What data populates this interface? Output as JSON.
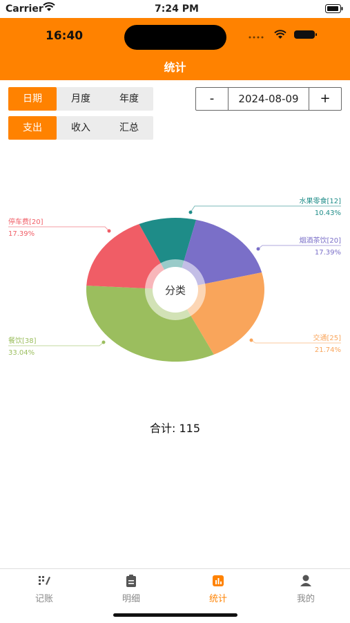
{
  "sim_status": {
    "carrier": "Carrier",
    "time": "7:24 PM"
  },
  "device_status": {
    "time": "16:40"
  },
  "header": {
    "title": "统计"
  },
  "period_tabs": [
    {
      "label": "日期",
      "active": true
    },
    {
      "label": "月度",
      "active": false
    },
    {
      "label": "年度",
      "active": false
    }
  ],
  "type_tabs": [
    {
      "label": "支出",
      "active": true
    },
    {
      "label": "收入",
      "active": false
    },
    {
      "label": "汇总",
      "active": false
    }
  ],
  "date_control": {
    "minus": "-",
    "value": "2024-08-09",
    "plus": "+"
  },
  "chart_data": {
    "type": "pie",
    "center_label": "分类",
    "slices": [
      {
        "label": "水果零食[12]",
        "percent": "10.43%",
        "value": 12,
        "color": "#1E8C88"
      },
      {
        "label": "烟酒茶饮[20]",
        "percent": "17.39%",
        "value": 20,
        "color": "#7A6FC8"
      },
      {
        "label": "交通[25]",
        "percent": "21.74%",
        "value": 25,
        "color": "#F9A55B"
      },
      {
        "label": "餐饮[38]",
        "percent": "33.04%",
        "value": 38,
        "color": "#9BBE5E"
      },
      {
        "label": "停车费[20]",
        "percent": "17.39%",
        "value": 20,
        "color": "#F05D66"
      }
    ]
  },
  "total": {
    "text": "合计: 115"
  },
  "tabbar": [
    {
      "label": "记账",
      "icon": "bookkeeping-icon",
      "active": false
    },
    {
      "label": "明细",
      "icon": "clipboard-icon",
      "active": false
    },
    {
      "label": "统计",
      "icon": "bar-chart-icon",
      "active": true
    },
    {
      "label": "我的",
      "icon": "person-icon",
      "active": false
    }
  ]
}
